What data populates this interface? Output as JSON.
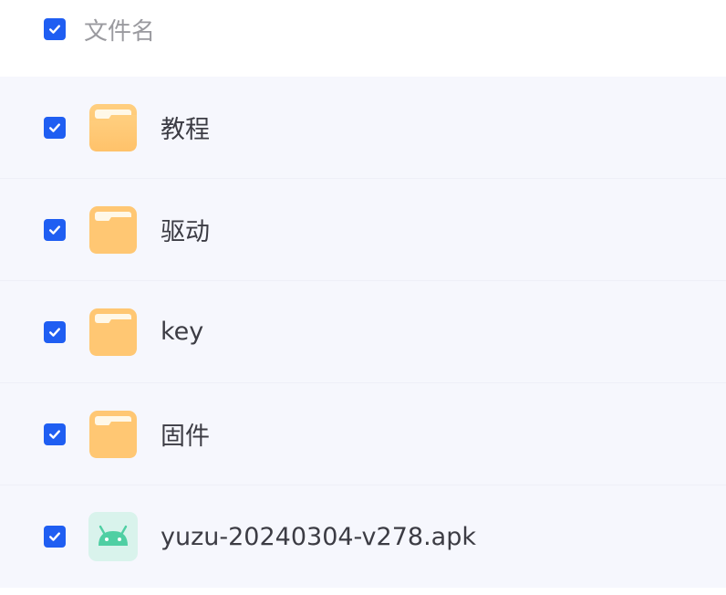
{
  "header": {
    "checked": true,
    "label": "文件名"
  },
  "files": [
    {
      "name": "教程",
      "type": "folder",
      "icon": "folder-icon",
      "checked": true
    },
    {
      "name": "驱动",
      "type": "folder",
      "icon": "folder-icon",
      "checked": true
    },
    {
      "name": "key",
      "type": "folder",
      "icon": "folder-icon",
      "checked": true
    },
    {
      "name": "固件",
      "type": "folder",
      "icon": "folder-icon",
      "checked": true
    },
    {
      "name": "yuzu-20240304-v278.apk",
      "type": "apk",
      "icon": "android-icon",
      "checked": true
    }
  ],
  "colors": {
    "checkbox": "#1f5ef2",
    "folder": "#ffc773",
    "android_bg": "#d9f3ec",
    "android": "#4fcfa3",
    "row_bg": "#f6f7fd"
  }
}
